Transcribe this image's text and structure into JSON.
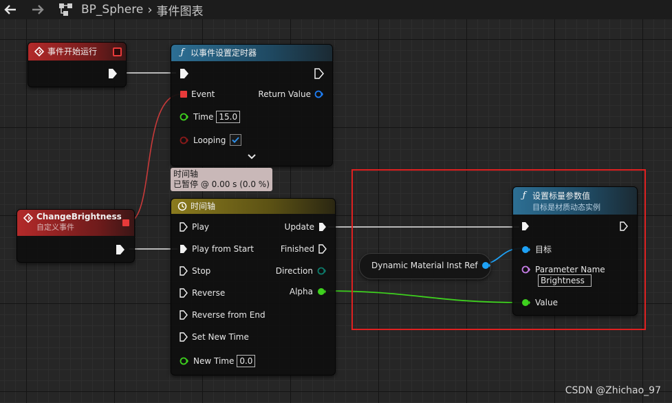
{
  "topbar": {
    "breadcrumb_blueprint": "BP_Sphere",
    "breadcrumb_graph": "事件图表"
  },
  "node_begin_play": {
    "title": "事件开始运行"
  },
  "node_set_timer": {
    "title": "以事件设置定时器",
    "pin_event": "Event",
    "pin_return": "Return Value",
    "pin_time": "Time",
    "time_value": "15.0",
    "pin_looping": "Looping",
    "looping_checked": true
  },
  "tooltip": {
    "line1": "时间轴",
    "line2": "已暂停 @ 0.00 s (0.0 %)"
  },
  "node_custom_event": {
    "title": "ChangeBrightness",
    "subtitle": "自定义事件"
  },
  "node_timeline": {
    "title": "时间轴",
    "inputs": [
      "Play",
      "Play from Start",
      "Stop",
      "Reverse",
      "Reverse from End",
      "Set New Time"
    ],
    "outputs": [
      "Update",
      "Finished",
      "Direction",
      "Alpha"
    ],
    "pin_new_time": "New Time",
    "new_time_value": "0.0"
  },
  "node_var": {
    "label": "Dynamic Material Inst Ref"
  },
  "node_set_scalar": {
    "title": "设置标量参数值",
    "subtitle": "目标是材质动态实例",
    "pin_target": "目标",
    "pin_param_name": "Parameter Name",
    "param_name_value": "Brightness",
    "pin_value": "Value"
  },
  "watermark": "CSDN @Zhichao_97",
  "colors": {
    "exec": "#f2f2f2",
    "delegate_pin": "#e83a3a",
    "float_pin": "#3ed11e",
    "object_pin": "#1ea1f5",
    "name_pin": "#c77ee8",
    "bool_pin": "#8b1a1a",
    "highlight": "#e02020"
  }
}
